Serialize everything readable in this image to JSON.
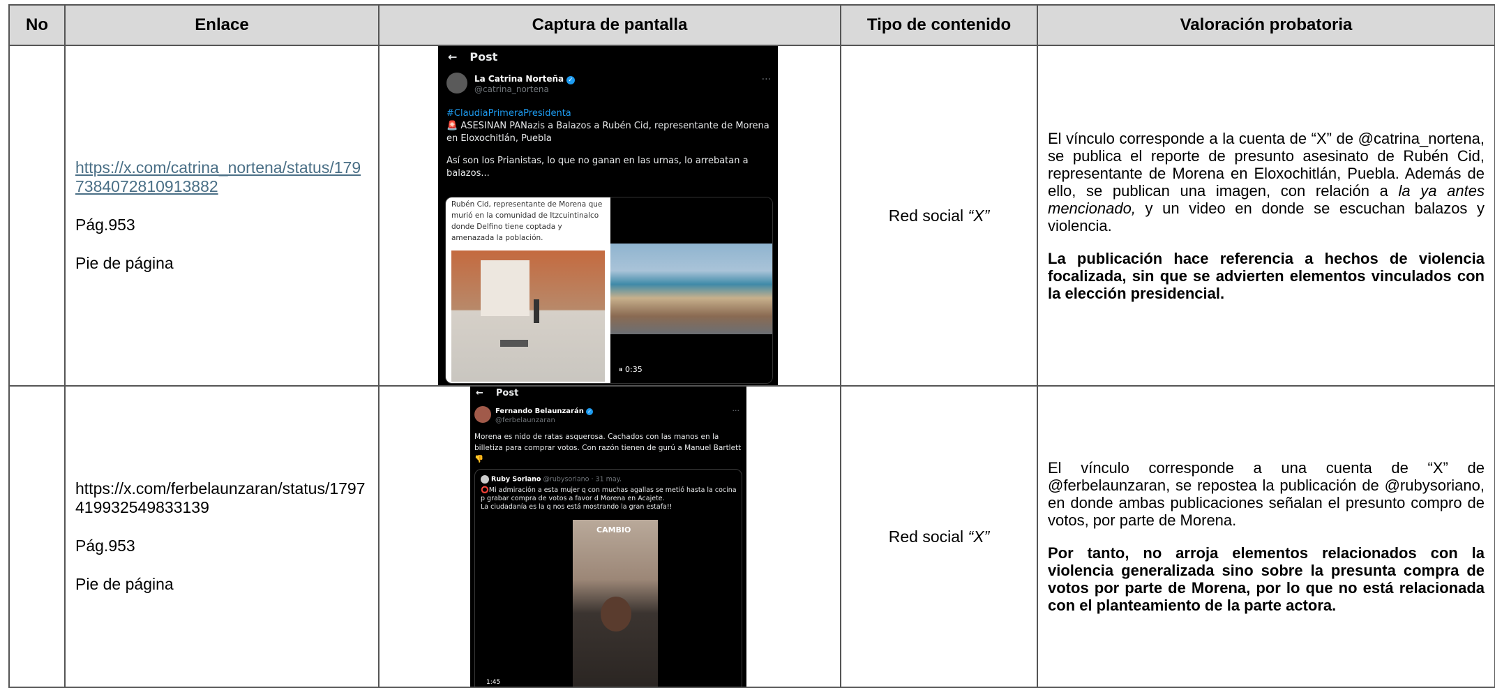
{
  "headers": {
    "no": "No",
    "enlace": "Enlace",
    "captura": "Captura de pantalla",
    "tipo": "Tipo de contenido",
    "valoracion": "Valoración probatoria"
  },
  "rows": [
    {
      "no": "",
      "link": "https://x.com/catrina_nortena/status/1797384072810913882",
      "page": "Pág.953",
      "footer": "Pie de página",
      "type_prefix": "Red social ",
      "type_italic": "“X”",
      "val_p1_a": "El vínculo corresponde a la cuenta de “X” de @catrina_nortena, se publica el reporte de presunto asesinato de Rubén Cid, representante de Morena en Eloxochitlán, Puebla. Además de ello, se publican una imagen, con relación a ",
      "val_p1_italic": "la ya antes mencionado,",
      "val_p1_b": " y un video en donde se escuchan balazos y violencia.",
      "val_p2": "La publicación hace referencia a hechos de violencia focalizada, sin que se advierten elementos vinculados con la elección presidencial.",
      "tweet": {
        "back": "←",
        "title": "Post",
        "name": "La Catrina Norteña",
        "handle": "@catrina_nortena",
        "dots": "···",
        "hashtag": "#ClaudiaPrimeraPresidenta",
        "line1": "🚨 ASESINAN PANazis a Balazos a Rubén Cid, representante de Morena en Eloxochitlán, Puebla",
        "line2": "Así son los Prianistas, lo que no ganan en las urnas, lo arrebatan a balazos...",
        "media_caption": "Rubén Cid, representante de Morena que murió en la comunidad de Itzcuintinalco donde Delfino tiene coptada y amenazada la población.",
        "video_time": "⏸ 0:35"
      }
    },
    {
      "no": "",
      "link": "https://x.com/ferbelaunzaran/status/1797419932549833139",
      "page": "Pág.953",
      "footer": "Pie de página",
      "type_prefix": "Red social ",
      "type_italic": "“X”",
      "val_p1": "El vínculo corresponde a una cuenta de “X” de @ferbelaunzaran, se repostea la publicación de @rubysoriano, en donde ambas publicaciones señalan el presunto compro de votos, por parte de Morena.",
      "val_p2": "Por tanto, no arroja elementos relacionados con la violencia generalizada sino sobre la presunta compra de votos por parte de Morena, por lo que no está relacionada con el planteamiento de la parte actora.",
      "tweet": {
        "back": "←",
        "title": "Post",
        "name": "Fernando Belaunzarán",
        "handle": "@ferbelaunzaran",
        "dots": "···",
        "text": "Morena es nido de ratas asquerosa. Cachados con las manos en la billetiza para comprar votos. Con razón tienen de gurú a Manuel Bartlett 👎",
        "quote_name": "Ruby Soriano",
        "quote_handle": "@rubysoriano · 31 may.",
        "quote_text": "⭕Mi admiración a esta mujer q con muchas agallas se metió hasta la cocina p grabar compra de votos a favor d Morena en Acajete.",
        "quote_text2": "La ciudadanía es la q nos está mostrando la gran estafa!!",
        "video_label": "CAMBIO",
        "video_time": "1:45"
      }
    }
  ]
}
